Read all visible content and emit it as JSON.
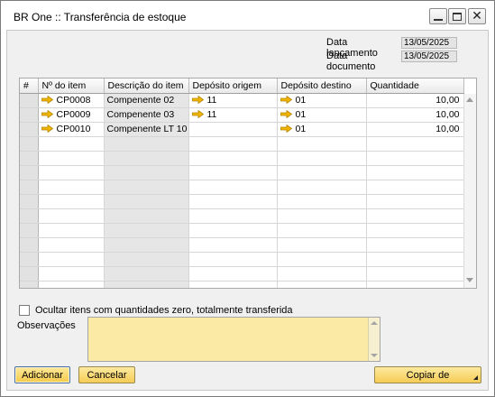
{
  "window": {
    "title": "BR One :: Transferência de estoque",
    "controls": {
      "minimize_icon": "minimize-icon",
      "maximize_icon": "maximize-icon",
      "close_icon": "close-icon",
      "close_glyph": "✕"
    }
  },
  "header": {
    "posting_date_label": "Data lançamento",
    "posting_date_value": "13/05/2025",
    "document_date_label": "Data documento",
    "document_date_value": "13/05/2025"
  },
  "grid": {
    "columns": [
      "#",
      "Nº do item",
      "Descrição do item",
      "Depósito origem",
      "Depósito destino",
      "Quantidade"
    ],
    "rows": [
      {
        "item": "CP0008",
        "description": "Compenente 02",
        "from_warehouse": "11",
        "to_warehouse": "01",
        "quantity": "10,00"
      },
      {
        "item": "CP0009",
        "description": "Compenente 03",
        "from_warehouse": "11",
        "to_warehouse": "01",
        "quantity": "10,00"
      },
      {
        "item": "CP0010",
        "description": "Compenente LT 10",
        "from_warehouse": "",
        "to_warehouse": "01",
        "quantity": "10,00"
      }
    ],
    "empty_rows": 11,
    "link_arrow_color": "#f2b600"
  },
  "options": {
    "hide_zero_label": "Ocultar itens com quantidades zero, totalmente transferida",
    "hide_zero_checked": false
  },
  "remarks": {
    "label": "Observações",
    "value": "",
    "field_color": "#fbe9a6"
  },
  "buttons": {
    "add": "Adicionar",
    "cancel": "Cancelar",
    "copy_from": "Copiar de"
  }
}
